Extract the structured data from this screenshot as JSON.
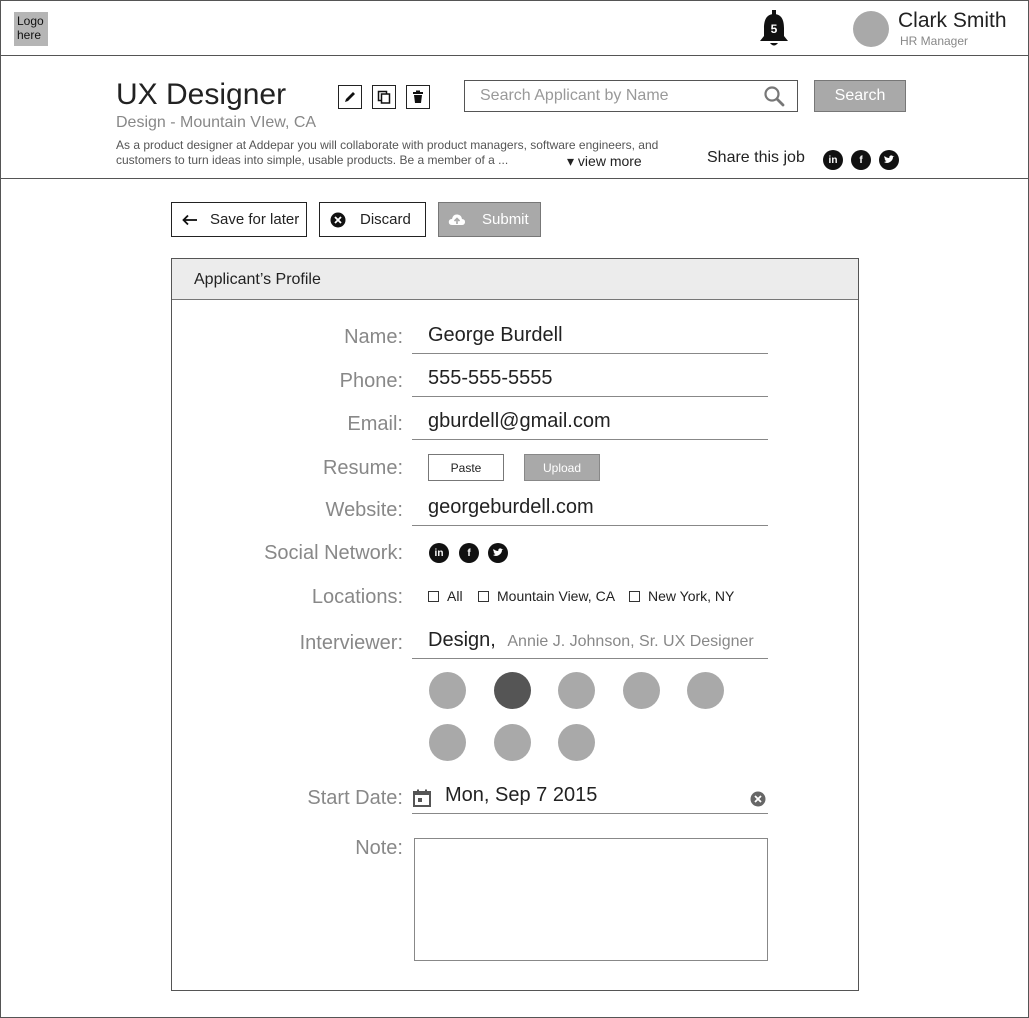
{
  "header": {
    "logo_text": "Logo here",
    "notifications_count": "5",
    "user": {
      "name": "Clark Smith",
      "role": "HR Manager"
    }
  },
  "job": {
    "title": "UX Designer",
    "location": "Design - Mountain VIew, CA",
    "description": "As a product designer at Addepar you will collaborate with product managers, software engineers, and customers to turn ideas into simple, usable products. Be a member of a ...",
    "view_more": "▾ view more",
    "tools": [
      "edit-icon",
      "copy-icon",
      "trash-icon"
    ],
    "search_placeholder": "Search Applicant by Name",
    "search_button": "Search",
    "share_label": "Share this job",
    "share_networks": [
      "in",
      "f",
      "t"
    ]
  },
  "actions": {
    "save_for_later": "Save for later",
    "discard": "Discard",
    "submit": "Submit"
  },
  "profile": {
    "title": "Applicant’s Profile",
    "labels": {
      "name": "Name:",
      "phone": "Phone:",
      "email": "Email:",
      "resume": "Resume:",
      "website": "Website:",
      "social": "Social Network:",
      "locations": "Locations:",
      "interviewer": "Interviewer:",
      "start_date": "Start Date:",
      "note": "Note:"
    },
    "values": {
      "name": "George Burdell",
      "phone": "555-555-5555",
      "email": "gburdell@gmail.com",
      "website": "georgeburdell.com",
      "interviewer_dept": "Design,",
      "interviewer_person": "Annie J. Johnson, Sr. UX Designer",
      "start_date": "Mon, Sep 7  2015",
      "note": ""
    },
    "resume_buttons": {
      "paste": "Paste",
      "upload": "Upload"
    },
    "social_networks": [
      "in",
      "f",
      "t"
    ],
    "locations": [
      "All",
      "Mountain View, CA",
      "New York, NY"
    ],
    "interviewer_avatars": {
      "count": 8,
      "selected_index": 1
    }
  },
  "colors": {
    "accent_gray": "#a9a9a9",
    "selected_avatar": "#555555"
  }
}
